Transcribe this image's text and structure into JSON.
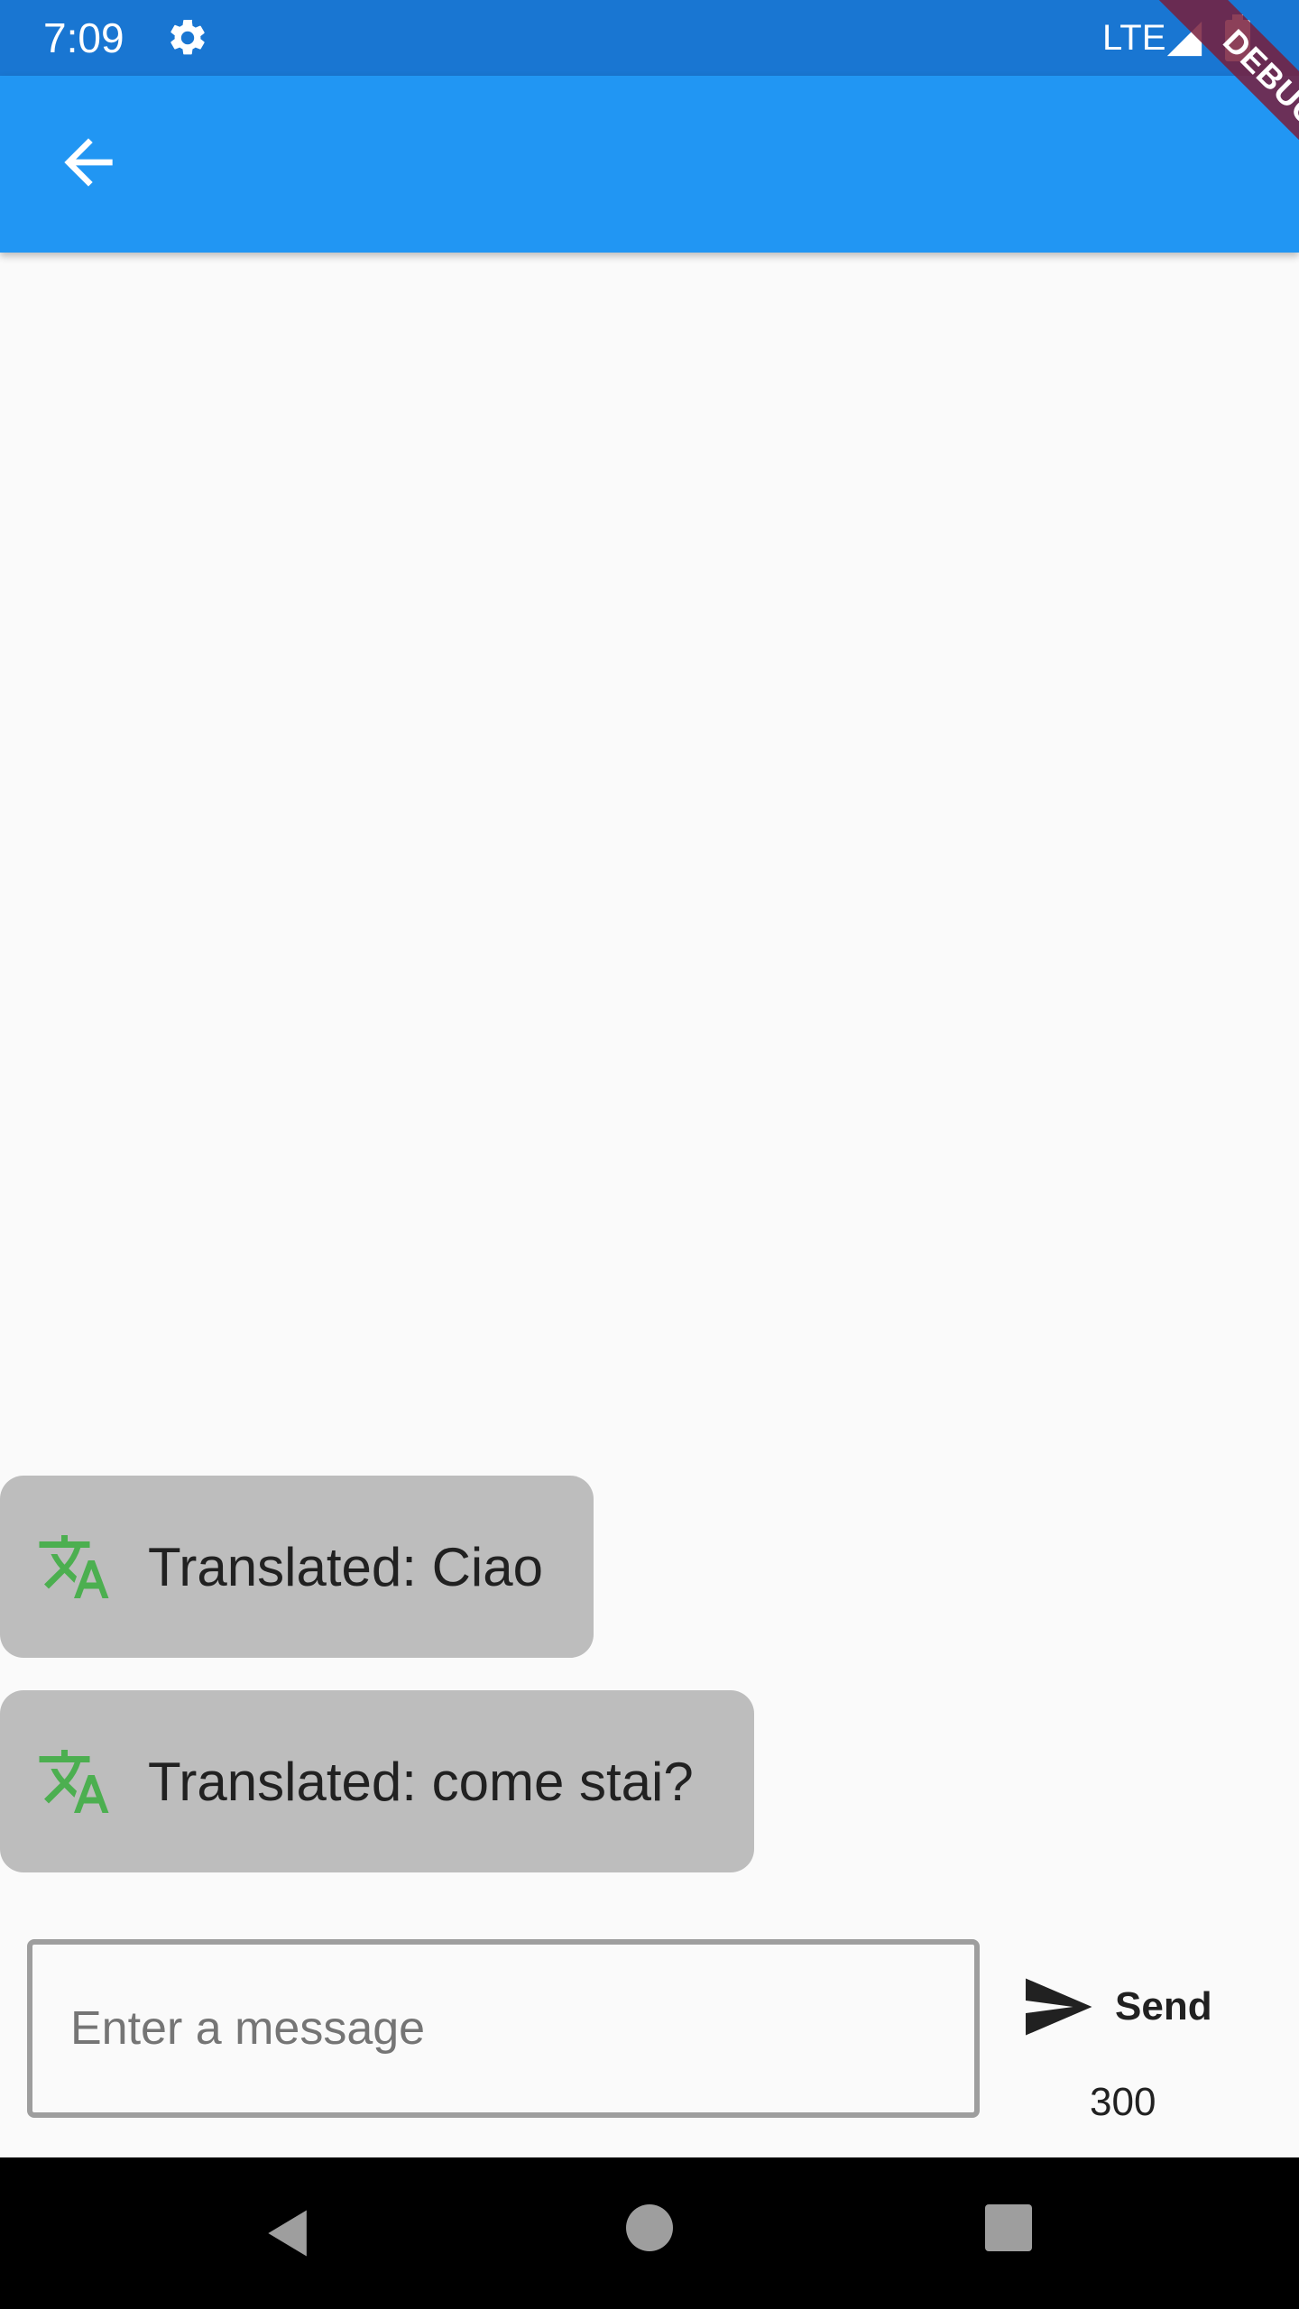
{
  "status_bar": {
    "time": "7:09",
    "network": "LTE"
  },
  "debug_banner": "DEBUG",
  "messages": [
    {
      "text": "Translated: Ciao",
      "icon": "translate-icon"
    },
    {
      "text": "Translated: come stai?",
      "icon": "translate-icon"
    }
  ],
  "composer": {
    "placeholder": "Enter a message",
    "value": "",
    "send_label": "Send",
    "char_counter": "300"
  },
  "colors": {
    "status_bar": "#1976d2",
    "app_bar": "#2196f3",
    "bubble": "#bdbdbd",
    "translate_icon": "#4caf50"
  }
}
